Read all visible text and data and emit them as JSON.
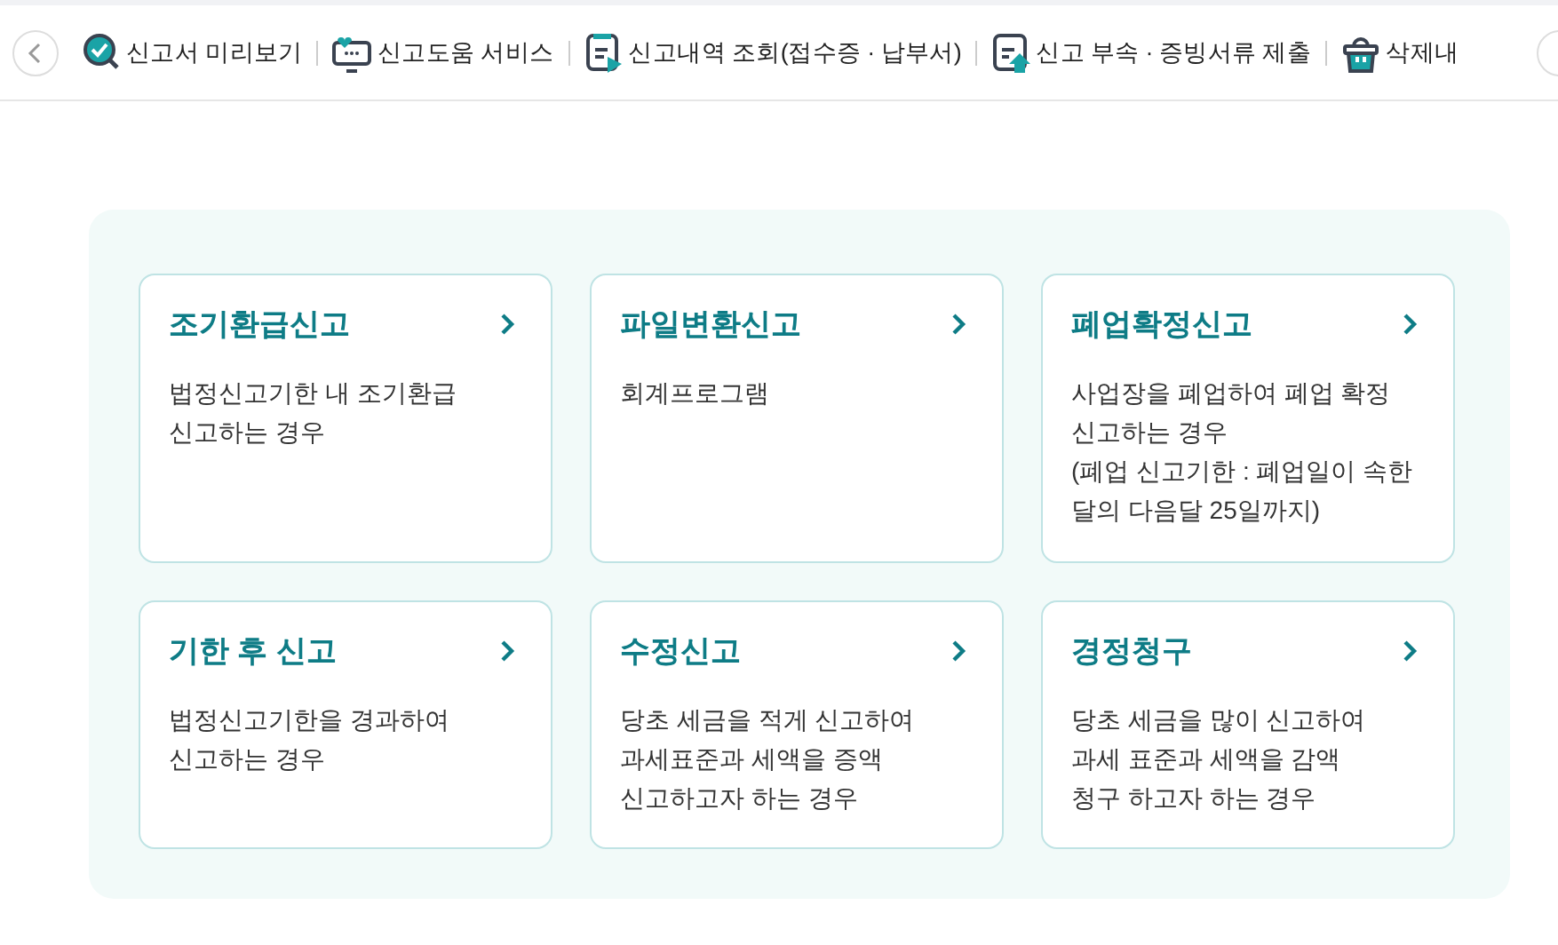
{
  "nav": {
    "items": [
      {
        "label": "신고서 미리보기"
      },
      {
        "label": "신고도움 서비스"
      },
      {
        "label": "신고내역 조회(접수증 · 납부서)"
      },
      {
        "label": "신고 부속 · 증빙서류 제출"
      },
      {
        "label": "삭제내"
      }
    ]
  },
  "cards": [
    {
      "title": "조기환급신고",
      "lines": [
        "법정신고기한 내 조기환급",
        "신고하는 경우"
      ]
    },
    {
      "title": "파일변환신고",
      "lines": [
        "회계프로그램"
      ]
    },
    {
      "title": "폐업확정신고",
      "lines": [
        "사업장을 폐업하여 폐업 확정",
        "신고하는 경우",
        "(폐업 신고기한 : 폐업일이 속한",
        "달의 다음달 25일까지)"
      ]
    },
    {
      "title": "기한 후 신고",
      "lines": [
        "법정신고기한을 경과하여",
        "신고하는 경우"
      ]
    },
    {
      "title": "수정신고",
      "lines": [
        "당초 세금을 적게 신고하여",
        "과세표준과 세액을 증액",
        "신고하고자 하는 경우"
      ]
    },
    {
      "title": "경정청구",
      "lines": [
        "당초 세금을 많이 신고하여",
        "과세 표준과 세액을 감액",
        "청구 하고자 하는 경우"
      ]
    }
  ]
}
